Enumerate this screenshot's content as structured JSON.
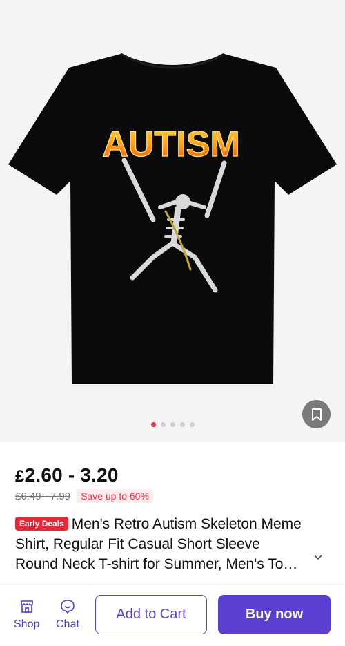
{
  "gallery": {
    "image_alt": "Black T-shirt with flaming AUTISM text and skeleton holding guns",
    "shirt_text": "AUTISM",
    "total_images": 5,
    "active_index": 0
  },
  "price": {
    "currency": "£",
    "range": "2.60 - 3.20",
    "original": "£6.49 - 7.99",
    "save_label": "Save up to 60%"
  },
  "product": {
    "deal_badge": "Early Deals",
    "title": "Men's Retro Autism Skeleton Meme Shirt, Regular Fit Casual Short Sleeve Round Neck T-shirt for Summer, Men's Top for ...",
    "expand_symbol": "..."
  },
  "bottom_bar": {
    "shop_label": "Shop",
    "chat_label": "Chat",
    "add_to_cart_label": "Add to Cart",
    "buy_now_label": "Buy now"
  },
  "colors": {
    "accent": "#5c3fd2",
    "sale": "#e8334a",
    "deal_badge": "#e02a38"
  }
}
